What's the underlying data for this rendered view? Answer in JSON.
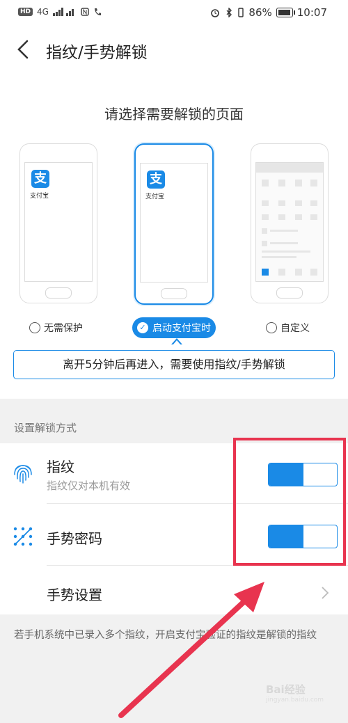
{
  "statusbar": {
    "left_chip": "HD",
    "network": "4G",
    "battery_percent": "86%",
    "time": "10:07"
  },
  "header": {
    "title": "指纹/手势解锁"
  },
  "picker": {
    "title": "请选择需要解锁的页面",
    "phones": [
      {
        "app_label": "支付宝"
      },
      {
        "app_label": "支付宝"
      }
    ],
    "options": [
      {
        "label": "无需保护",
        "selected": false
      },
      {
        "label": "启动支付宝时",
        "selected": true
      },
      {
        "label": "自定义",
        "selected": false
      }
    ],
    "notice": "离开5分钟后再进入，需要使用指纹/手势解锁"
  },
  "unlock_section": {
    "title": "设置解锁方式",
    "fingerprint": {
      "title": "指纹",
      "subtitle": "指纹仅对本机有效",
      "enabled": true
    },
    "gesture": {
      "title": "手势密码",
      "enabled": true
    },
    "gesture_settings": {
      "title": "手势设置"
    }
  },
  "footnote": "若手机系统中已录入多个指纹，开启支付宝验证的指纹是解锁的指纹",
  "watermark": {
    "text": "Bai经验",
    "sub": "jingyan.baidu.com"
  },
  "colors": {
    "accent": "#1a8ae6",
    "annotation": "#e8344f"
  },
  "icons": {
    "back": "chevron-left-icon",
    "fingerprint": "fingerprint-icon",
    "gesture": "gesture-dots-icon",
    "forward": "chevron-right-icon"
  }
}
